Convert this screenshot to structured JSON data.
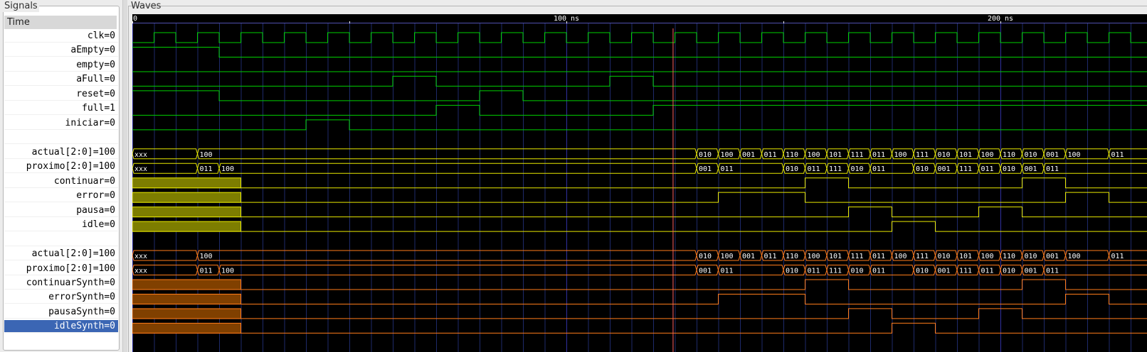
{
  "panels": {
    "signals_title": "Signals",
    "waves_title": "Waves",
    "time_header": "Time"
  },
  "time_axis": {
    "labels": [
      "0",
      "100 ns",
      "200 ns"
    ],
    "label_times_ns": [
      0,
      100,
      200
    ],
    "cursor_time_ns": 124.5
  },
  "colors": {
    "digital": "#00d000",
    "bus_yellow": "#e8e800",
    "fill_yellow": "#7d7d00",
    "bus_orange": "#ff7c1a",
    "fill_orange": "#804000",
    "cursor": "#ff6060",
    "grid": "#1e2a6a"
  },
  "signals": [
    {
      "name": "clk",
      "value": "0",
      "kind": "clock",
      "color": "digital",
      "period_ns": 10,
      "first_rise_ns": 5
    },
    {
      "name": "aEmpty",
      "value": "0",
      "kind": "bit",
      "color": "digital",
      "init": 1,
      "events": [
        [
          20,
          0
        ]
      ]
    },
    {
      "name": "empty",
      "value": "0",
      "kind": "bit",
      "color": "digital",
      "init": 0,
      "events": []
    },
    {
      "name": "aFull",
      "value": "0",
      "kind": "bit",
      "color": "digital",
      "init": 0,
      "events": [
        [
          60,
          1
        ],
        [
          70,
          0
        ],
        [
          110,
          1
        ],
        [
          120,
          0
        ]
      ]
    },
    {
      "name": "reset",
      "value": "0",
      "kind": "bit",
      "color": "digital",
      "init": 1,
      "events": [
        [
          20,
          0
        ],
        [
          80,
          1
        ],
        [
          90,
          0
        ]
      ]
    },
    {
      "name": "full",
      "value": "1",
      "kind": "bit",
      "color": "digital",
      "init": 0,
      "events": [
        [
          70,
          1
        ],
        [
          80,
          0
        ],
        [
          120,
          1
        ]
      ]
    },
    {
      "name": "iniciar",
      "value": "0",
      "kind": "bit",
      "color": "digital",
      "init": 0,
      "events": [
        [
          40,
          1
        ],
        [
          50,
          0
        ]
      ]
    },
    {
      "name": "",
      "value": "",
      "kind": "blank"
    },
    {
      "name": "actual[2:0]",
      "value": "100",
      "kind": "bus",
      "color": "bus_yellow",
      "times": [
        0,
        15,
        130,
        135,
        140,
        145,
        150,
        155,
        160,
        165,
        170,
        175,
        180,
        185,
        190,
        195,
        200,
        205,
        210,
        215,
        225
      ],
      "labels": [
        "xxx",
        "100",
        "010",
        "100",
        "001",
        "011",
        "110",
        "100",
        "101",
        "111",
        "011",
        "100",
        "111",
        "010",
        "101",
        "100",
        "110",
        "010",
        "001",
        "100",
        "011"
      ]
    },
    {
      "name": "proximo[2:0]",
      "value": "100",
      "kind": "bus",
      "color": "bus_yellow",
      "times": [
        0,
        15,
        20,
        130,
        135,
        150,
        155,
        160,
        165,
        170,
        180,
        185,
        190,
        195,
        200,
        205,
        210
      ],
      "labels": [
        "xxx",
        "011",
        "100",
        "001",
        "011",
        "010",
        "011",
        "111",
        "010",
        "011",
        "010",
        "001",
        "111",
        "011",
        "010",
        "001",
        "011"
      ]
    },
    {
      "name": "continuar",
      "value": "0",
      "kind": "bit",
      "color": "bus_yellow",
      "fill": "fill_yellow",
      "fill_until_ns": 25,
      "init": 0,
      "events": [
        [
          155,
          1
        ],
        [
          165,
          0
        ],
        [
          205,
          1
        ],
        [
          215,
          0
        ]
      ]
    },
    {
      "name": "error",
      "value": "0",
      "kind": "bit",
      "color": "bus_yellow",
      "fill": "fill_yellow",
      "fill_until_ns": 25,
      "init": 0,
      "events": [
        [
          135,
          1
        ],
        [
          155,
          0
        ],
        [
          215,
          1
        ],
        [
          225,
          0
        ]
      ]
    },
    {
      "name": "pausa",
      "value": "0",
      "kind": "bit",
      "color": "bus_yellow",
      "fill": "fill_yellow",
      "fill_until_ns": 25,
      "init": 0,
      "events": [
        [
          165,
          1
        ],
        [
          175,
          0
        ],
        [
          195,
          1
        ],
        [
          205,
          0
        ]
      ]
    },
    {
      "name": "idle",
      "value": "0",
      "kind": "bit",
      "color": "bus_yellow",
      "fill": "fill_yellow",
      "fill_until_ns": 25,
      "init": 0,
      "events": [
        [
          175,
          1
        ],
        [
          185,
          0
        ]
      ]
    },
    {
      "name": "",
      "value": "",
      "kind": "blank"
    },
    {
      "name": "actual[2:0]",
      "value": "100",
      "kind": "bus",
      "color": "bus_orange",
      "times": [
        0,
        15,
        130,
        135,
        140,
        145,
        150,
        155,
        160,
        165,
        170,
        175,
        180,
        185,
        190,
        195,
        200,
        205,
        210,
        215,
        225
      ],
      "labels": [
        "xxx",
        "100",
        "010",
        "100",
        "001",
        "011",
        "110",
        "100",
        "101",
        "111",
        "011",
        "100",
        "111",
        "010",
        "101",
        "100",
        "110",
        "010",
        "001",
        "100",
        "011"
      ]
    },
    {
      "name": "proximo[2:0]",
      "value": "100",
      "kind": "bus",
      "color": "bus_orange",
      "times": [
        0,
        15,
        20,
        130,
        135,
        150,
        155,
        160,
        165,
        170,
        180,
        185,
        190,
        195,
        200,
        205,
        210
      ],
      "labels": [
        "xxx",
        "011",
        "100",
        "001",
        "011",
        "010",
        "011",
        "111",
        "010",
        "011",
        "010",
        "001",
        "111",
        "011",
        "010",
        "001",
        "011"
      ]
    },
    {
      "name": "continuarSynth",
      "value": "0",
      "kind": "bit",
      "color": "bus_orange",
      "fill": "fill_orange",
      "fill_until_ns": 25,
      "init": 0,
      "events": [
        [
          155,
          1
        ],
        [
          165,
          0
        ],
        [
          205,
          1
        ],
        [
          215,
          0
        ]
      ]
    },
    {
      "name": "errorSynth",
      "value": "0",
      "kind": "bit",
      "color": "bus_orange",
      "fill": "fill_orange",
      "fill_until_ns": 25,
      "init": 0,
      "events": [
        [
          135,
          1
        ],
        [
          155,
          0
        ],
        [
          215,
          1
        ],
        [
          225,
          0
        ]
      ]
    },
    {
      "name": "pausaSynth",
      "value": "0",
      "kind": "bit",
      "color": "bus_orange",
      "fill": "fill_orange",
      "fill_until_ns": 25,
      "init": 0,
      "events": [
        [
          165,
          1
        ],
        [
          175,
          0
        ],
        [
          195,
          1
        ],
        [
          205,
          0
        ]
      ]
    },
    {
      "name": "idleSynth",
      "value": "0",
      "kind": "bit",
      "color": "bus_orange",
      "fill": "fill_orange",
      "fill_until_ns": 25,
      "init": 0,
      "events": [
        [
          175,
          1
        ],
        [
          185,
          0
        ]
      ],
      "selected": true
    }
  ]
}
